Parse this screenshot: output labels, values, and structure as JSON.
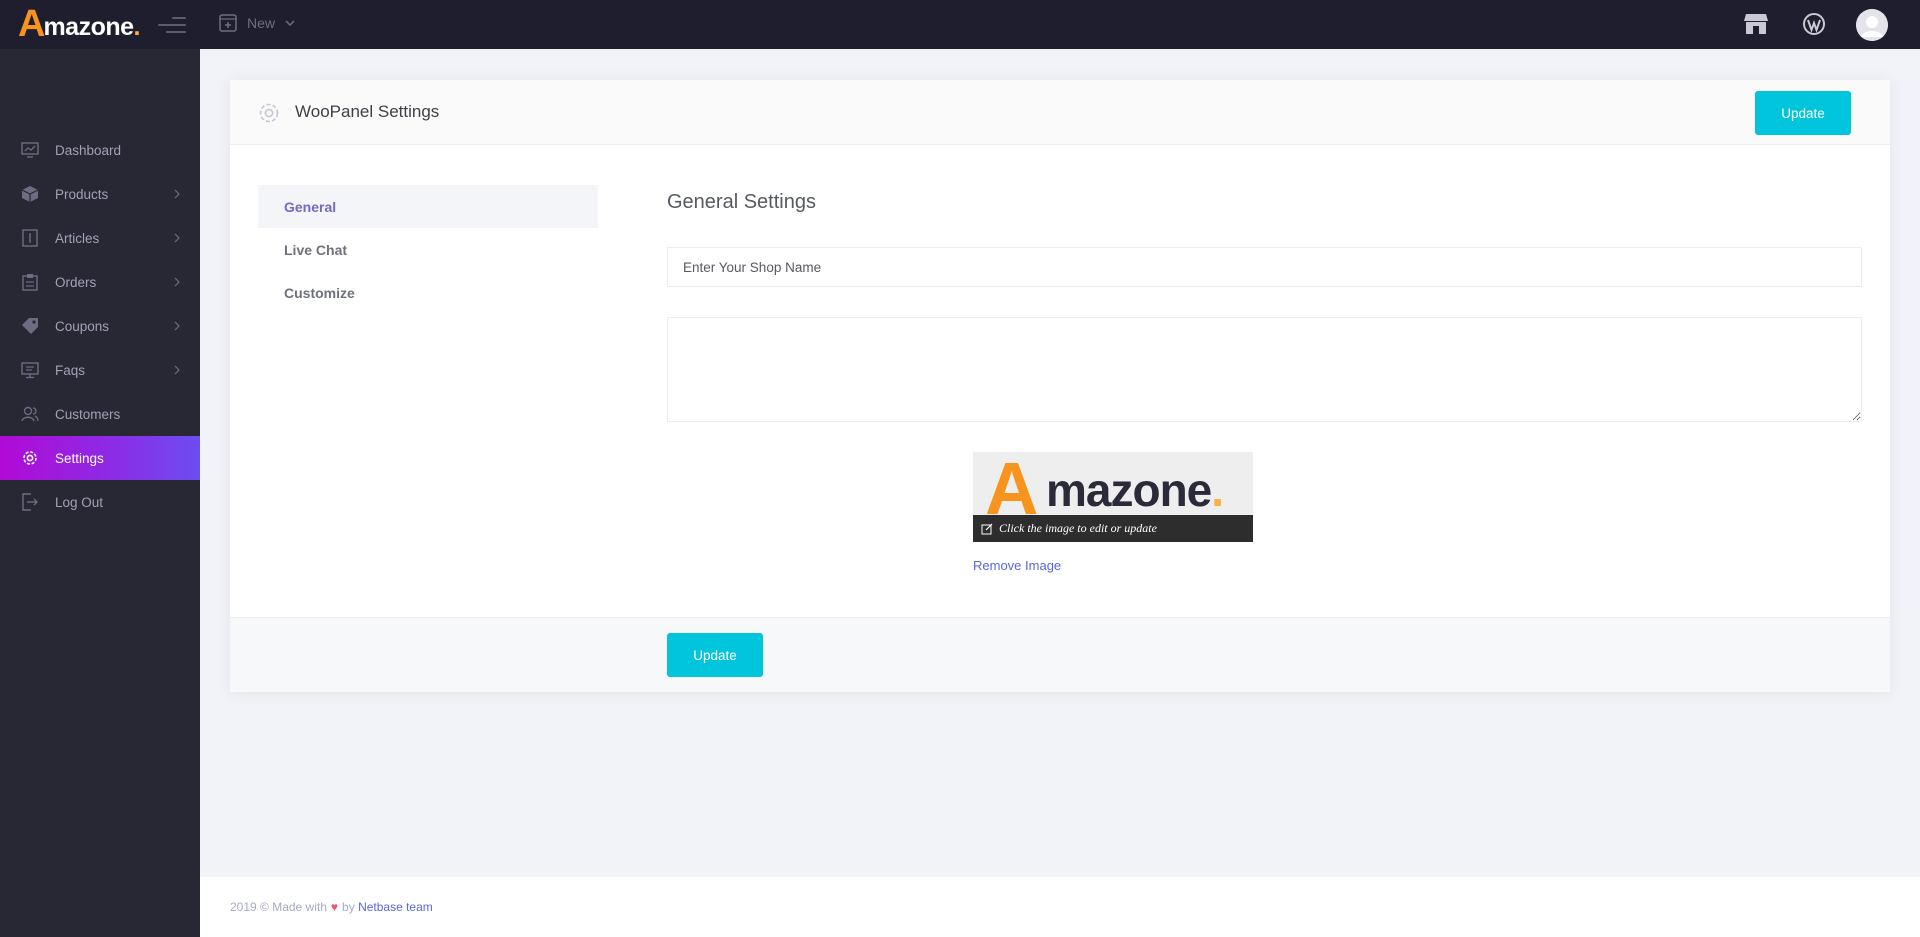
{
  "brand": {
    "letter": "A",
    "rest": "mazone",
    "dot": "."
  },
  "topbar": {
    "new_label": "New"
  },
  "sidebar": {
    "items": [
      {
        "label": "Dashboard",
        "icon": "dashboard-icon",
        "has_chevron": false
      },
      {
        "label": "Products",
        "icon": "box-icon",
        "has_chevron": true
      },
      {
        "label": "Articles",
        "icon": "article-icon",
        "has_chevron": true
      },
      {
        "label": "Orders",
        "icon": "clipboard-icon",
        "has_chevron": true
      },
      {
        "label": "Coupons",
        "icon": "tag-icon",
        "has_chevron": true
      },
      {
        "label": "Faqs",
        "icon": "monitor-icon",
        "has_chevron": true
      },
      {
        "label": "Customers",
        "icon": "users-icon",
        "has_chevron": false
      },
      {
        "label": "Settings",
        "icon": "gear-icon",
        "has_chevron": false,
        "active": true
      },
      {
        "label": "Log Out",
        "icon": "logout-icon",
        "has_chevron": false
      }
    ]
  },
  "card": {
    "title": "WooPanel Settings",
    "update_label": "Update",
    "tabs": [
      {
        "label": "General",
        "active": true
      },
      {
        "label": "Live Chat"
      },
      {
        "label": "Customize"
      }
    ],
    "section_title": "General Settings",
    "shop_name_placeholder": "Enter Your Shop Name",
    "image_caption": "Click the image to edit or update",
    "remove_image_label": "Remove Image",
    "bottom_update_label": "Update"
  },
  "footer": {
    "prefix": "2019 © Made with",
    "by": "by",
    "team": "Netbase team"
  },
  "colors": {
    "accent": "#00c5dc",
    "active_gradient_start": "#b10ad6",
    "active_gradient_end": "#6c4ef0",
    "brand_orange": "#f7941d",
    "link": "#5867dd"
  }
}
